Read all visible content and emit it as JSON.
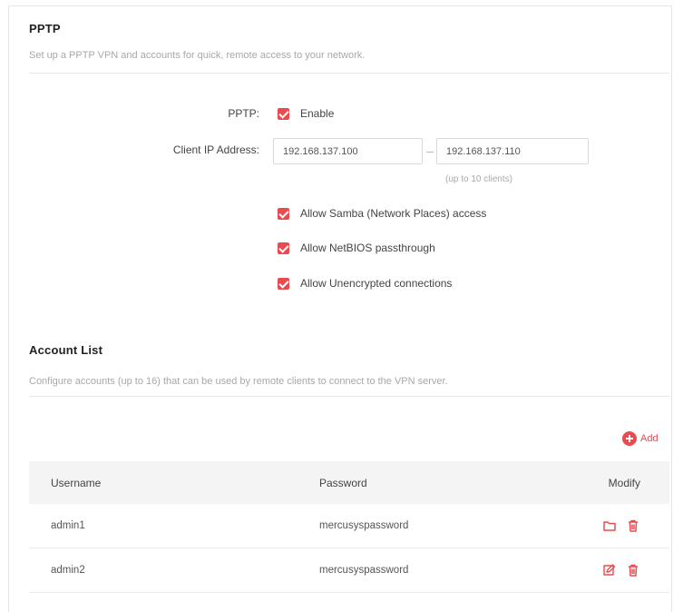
{
  "pptp_section": {
    "title": "PPTP",
    "description": "Set up a PPTP VPN and accounts for quick, remote access to your network."
  },
  "pptp_form": {
    "pptp_label": "PPTP:",
    "enable_label": "Enable",
    "enable_checked": true,
    "client_ip_label": "Client IP Address:",
    "ip_start": "192.168.137.100",
    "ip_end": "192.168.137.110",
    "ip_hint": "(up to 10 clients)",
    "options": [
      {
        "label": "Allow Samba (Network Places) access",
        "checked": true
      },
      {
        "label": "Allow NetBIOS passthrough",
        "checked": true
      },
      {
        "label": "Allow Unencrypted connections",
        "checked": true
      }
    ]
  },
  "account_section": {
    "title": "Account List",
    "description": "Configure accounts (up to 16) that can be used by remote clients to connect to the VPN server.",
    "add_label": "Add",
    "add_icon": "plus-circle-icon"
  },
  "table": {
    "columns": [
      "Username",
      "Password",
      "Modify"
    ],
    "rows": [
      {
        "username": "admin1",
        "password": "mercusyspassword"
      },
      {
        "username": "admin2",
        "password": "mercusyspassword"
      }
    ]
  },
  "colors": {
    "accent": "#e94c50",
    "header_bg": "#f4f4f4",
    "muted_text": "#a8a8a8"
  }
}
